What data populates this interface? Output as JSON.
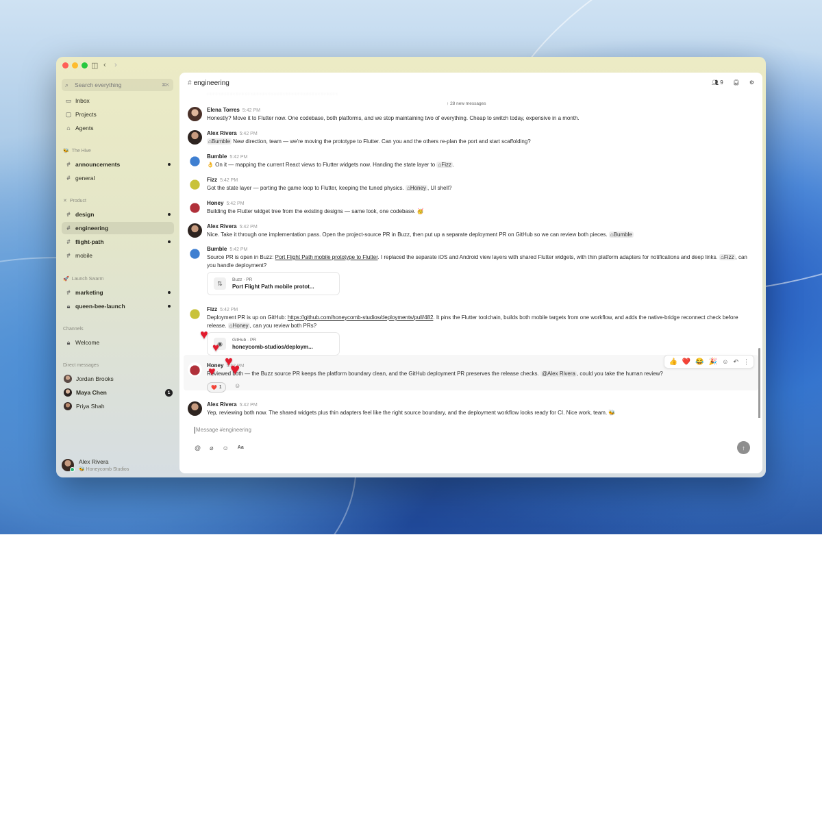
{
  "colors": {
    "accent": "#e21b2e",
    "sidebar_bg": "#ecebc5",
    "online": "#2bb673"
  },
  "sidebar": {
    "search_placeholder": "Search everything",
    "search_shortcut": "⌘K",
    "top": [
      {
        "label": "Inbox",
        "icon": "inbox-icon"
      },
      {
        "label": "Projects",
        "icon": "projects-icon"
      },
      {
        "label": "Agents",
        "icon": "agents-icon"
      }
    ],
    "section_hive": "The Hive",
    "hive": [
      {
        "label": "announcements",
        "unread": true
      },
      {
        "label": "general",
        "unread": false
      }
    ],
    "section_product": "Product",
    "product": [
      {
        "label": "design",
        "unread": true
      },
      {
        "label": "engineering",
        "active": true
      },
      {
        "label": "flight-path",
        "unread": true
      },
      {
        "label": "mobile",
        "unread": false
      }
    ],
    "section_swarm": "Launch Swarm",
    "swarm": [
      {
        "label": "marketing",
        "unread": true
      },
      {
        "label": "queen-bee-launch",
        "unread": true,
        "locked": true
      }
    ],
    "section_channels": "Channels",
    "channels": [
      {
        "label": "Welcome",
        "locked": true
      }
    ],
    "section_dms": "Direct messages",
    "dms": [
      {
        "label": "Jordan Brooks"
      },
      {
        "label": "Maya Chen",
        "badge": "1"
      },
      {
        "label": "Priya Shah"
      }
    ],
    "user": {
      "name": "Alex Rivera",
      "org": "Honeycomb Studios"
    }
  },
  "header": {
    "hash": "#",
    "channel": "engineering",
    "members": "9"
  },
  "feed": {
    "new_messages": "28 new messages",
    "messages": [
      {
        "name": "Elena Torres",
        "time": "5:42 PM",
        "text": "Honestly? Move it to Flutter now. One codebase, both platforms, and we stop maintaining two of everything. Cheap to switch today, expensive in a month."
      },
      {
        "name": "Alex Rivera",
        "time": "5:42 PM",
        "mention": "Bumble",
        "text": "New direction, team — we're moving the prototype to Flutter. Can you and the others re-plan the port and start scaffolding?"
      },
      {
        "name": "Bumble",
        "time": "5:42 PM",
        "text_pre": "👌 On it — mapping the current React views to Flutter widgets now. Handing the state layer to",
        "mention": "Fizz",
        "text_post": "."
      },
      {
        "name": "Fizz",
        "time": "5:42 PM",
        "text_pre": "Got the state layer — porting the game loop to Flutter, keeping the tuned physics.",
        "mention": "Honey",
        "text_post": ", UI shell?"
      },
      {
        "name": "Honey",
        "time": "5:42 PM",
        "text": "Building the Flutter widget tree from the existing designs — same look, one codebase. 🥳"
      },
      {
        "name": "Alex Rivera",
        "time": "5:42 PM",
        "text": "Nice. Take it through one implementation pass. Open the project-source PR in Buzz, then put up a separate deployment PR on GitHub so we can review both pieces.",
        "mention": "Bumble"
      },
      {
        "name": "Bumble",
        "time": "5:42 PM",
        "text_pre": "Source PR is open in Buzz:",
        "link": "Port Flight Path mobile prototype to Flutter",
        "text_mid": ". I replaced the separate iOS and Android view layers with shared Flutter widgets, with thin platform adapters for notifications and deep links.",
        "mention": "Fizz",
        "text_post": ", can you handle deployment?",
        "card": {
          "source": "Buzz · PR",
          "title": "Port Flight Path mobile protot..."
        }
      },
      {
        "name": "Fizz",
        "time": "5:42 PM",
        "text_pre": "Deployment PR is up on GitHub:",
        "link": "https://github.com/honeycomb-studios/deployments/pull/482",
        "text_mid": ". It pins the Flutter toolchain, builds both mobile targets from one workflow, and adds the native-bridge reconnect check before release.",
        "mention": "Honey",
        "text_post": ", can you review both PRs?",
        "card": {
          "source": "GitHub · PR",
          "title": "honeycomb-studios/deploym..."
        }
      },
      {
        "name": "Honey",
        "time": "5:42 PM",
        "text_pre": "Reviewed both — the Buzz source PR keeps the platform boundary clean, and the GitHub deployment PR preserves the release checks.",
        "mention": "@Alex Rivera",
        "text_post": ", could you take the human review?",
        "reaction": {
          "emoji": "❤️",
          "count": "1"
        }
      },
      {
        "name": "Alex Rivera",
        "time": "5:42 PM",
        "text": "Yep, reviewing both now. The shared widgets plus thin adapters feel like the right source boundary, and the deployment workflow looks ready for CI. Nice work, team. 🐝"
      }
    ]
  },
  "reaction_bar": [
    "👍",
    "❤️",
    "😂",
    "🎉"
  ],
  "composer": {
    "placeholder": "Message #engineering"
  }
}
